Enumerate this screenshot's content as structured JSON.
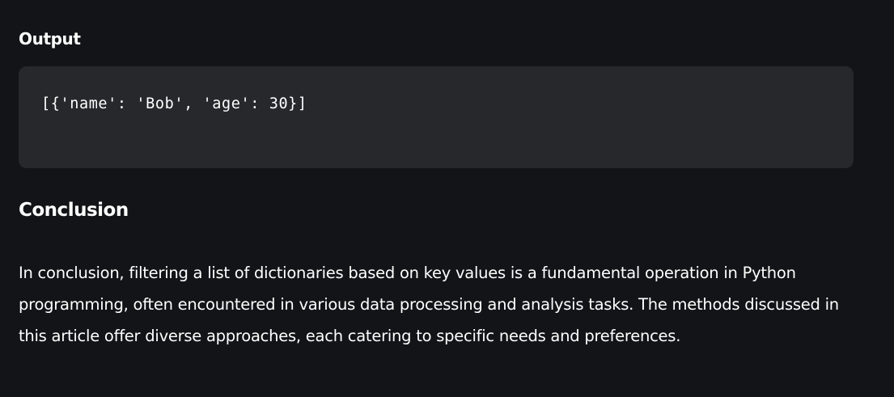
{
  "output_section": {
    "heading": "Output",
    "code": "[{'name': 'Bob', 'age': 30}]"
  },
  "conclusion_section": {
    "heading": "Conclusion",
    "paragraph": "In conclusion, filtering a list of dictionaries based on key values is a fundamental operation in Python programming, often encountered in various data processing and analysis tasks. The methods discussed in this article offer diverse approaches, each catering to specific needs and preferences."
  },
  "colors": {
    "background": "#131417",
    "code_background": "#27282c",
    "text": "#ffffff"
  }
}
